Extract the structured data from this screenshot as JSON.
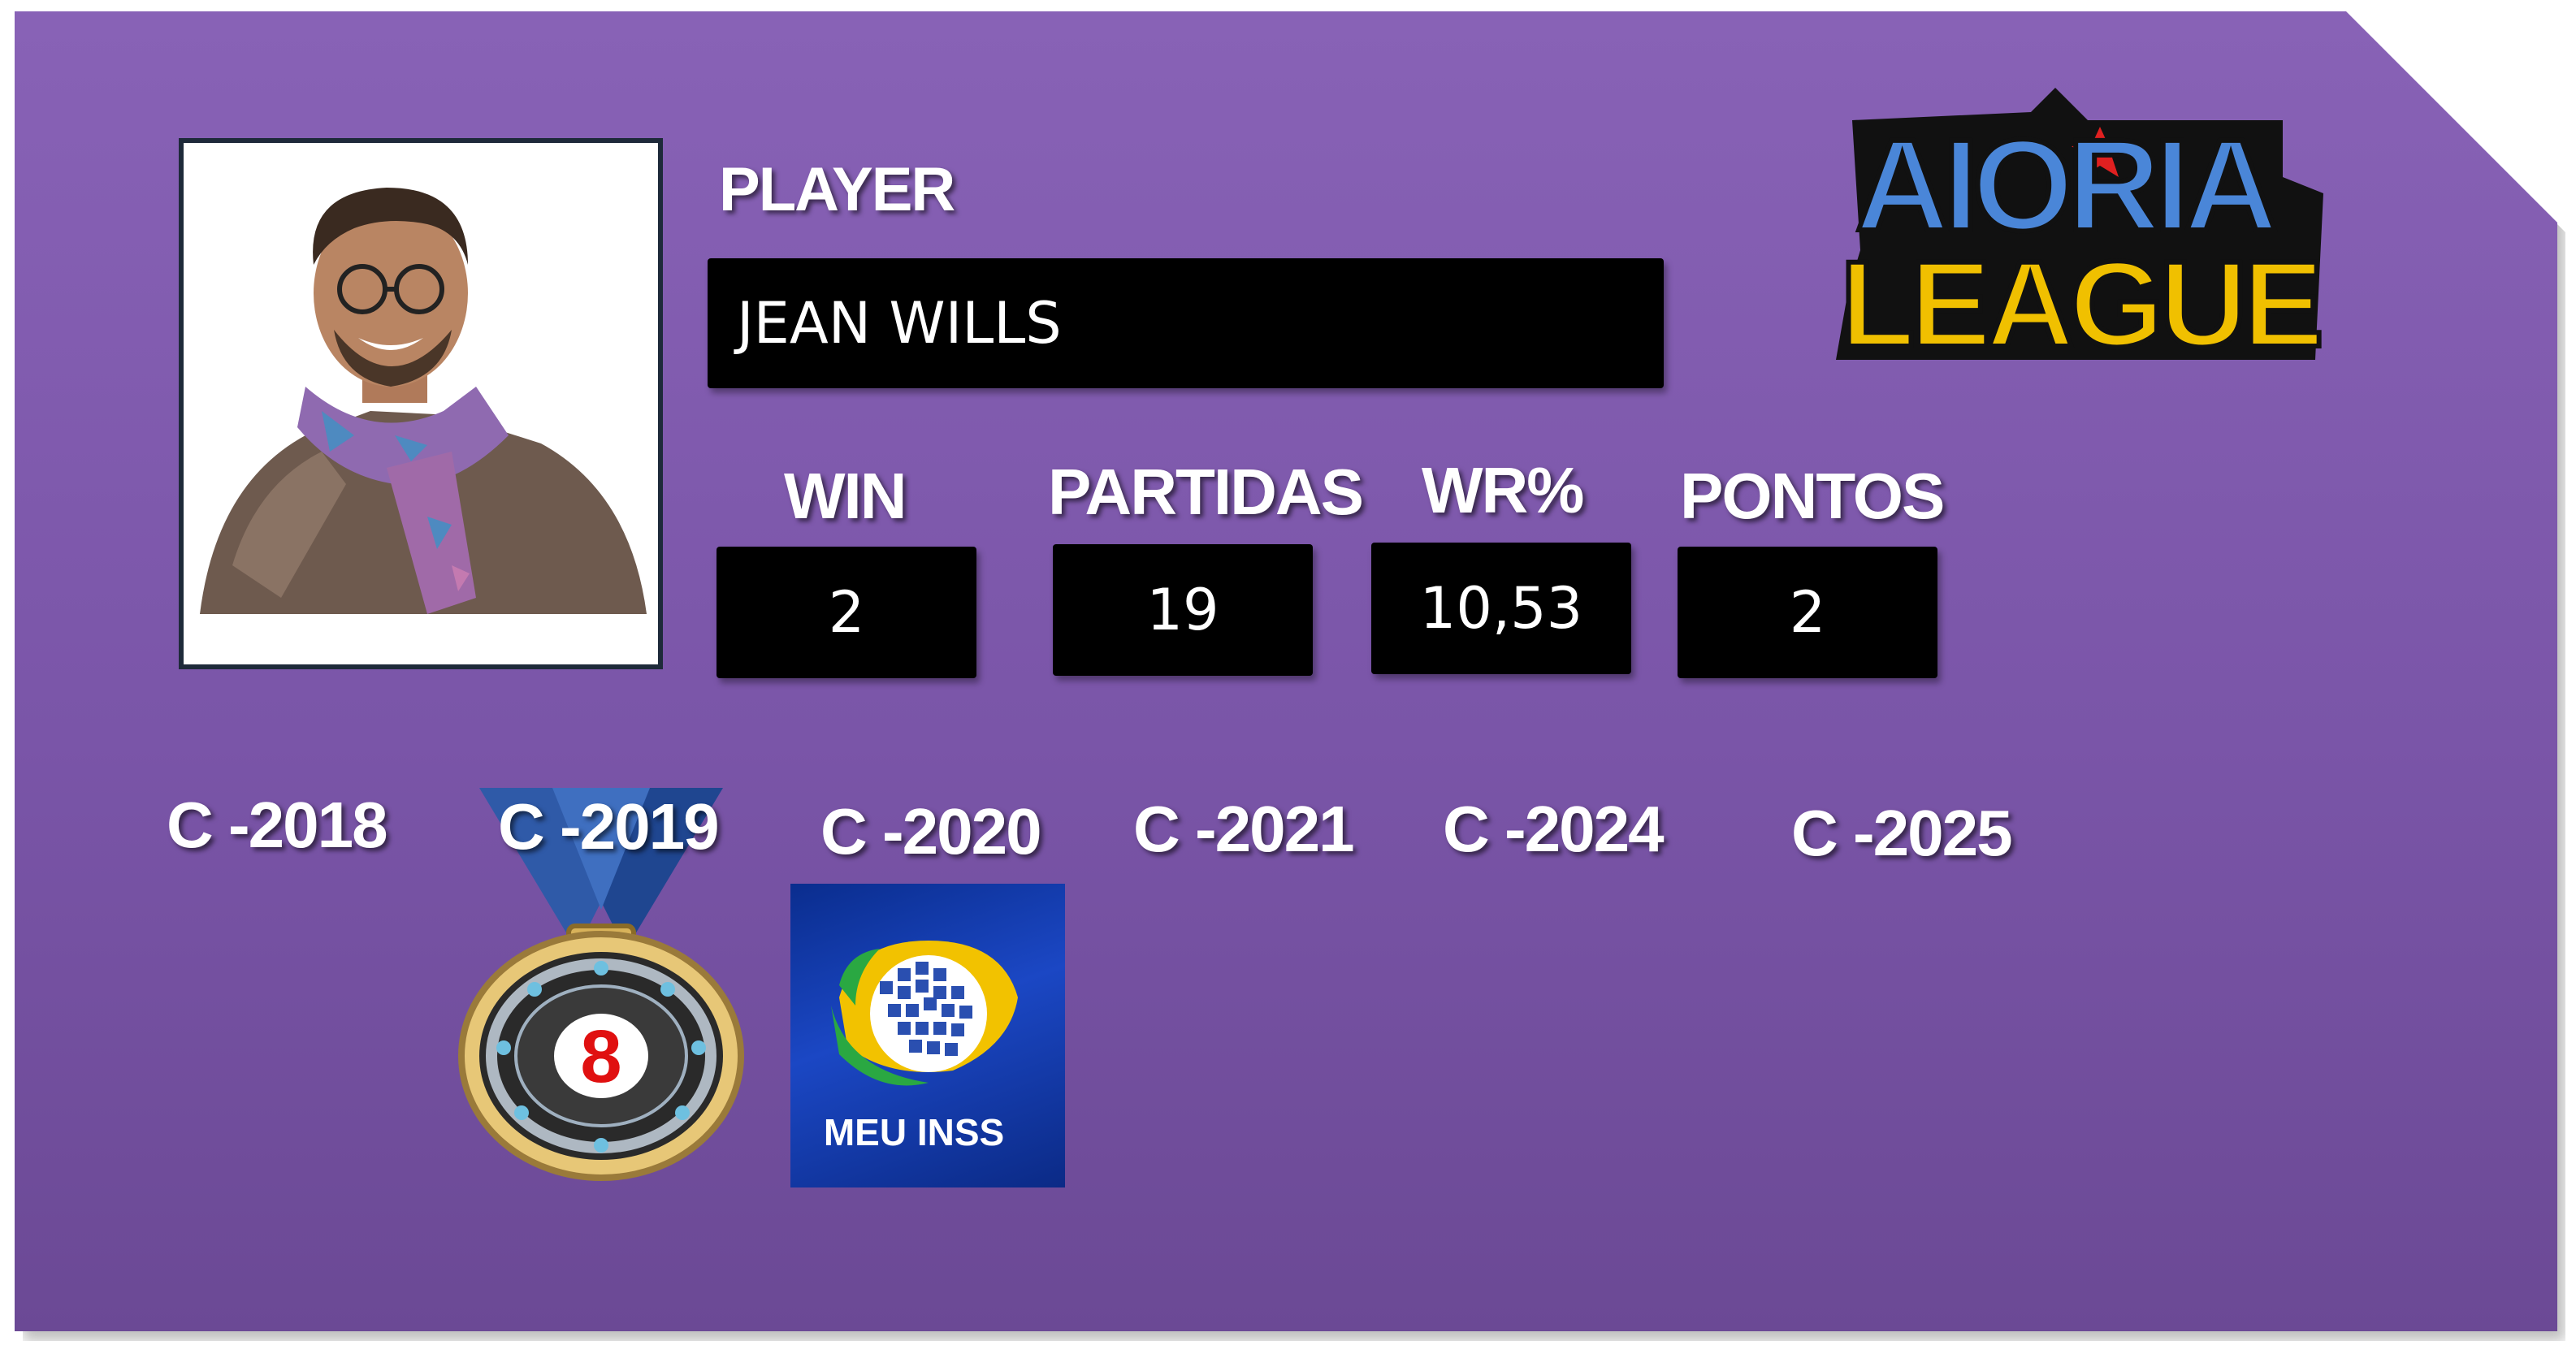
{
  "player": {
    "section_label": "PLAYER",
    "name": "JEAN WILLS"
  },
  "logo": {
    "line1": "AIORIA",
    "line2": "LEAGUE",
    "colors": {
      "top": "#4a86d8",
      "bottom": "#f0c000",
      "outline": "#111111",
      "star": "#e02020"
    }
  },
  "stats": [
    {
      "label": "WIN",
      "value": "2"
    },
    {
      "label": "PARTIDAS",
      "value": "19"
    },
    {
      "label": "WR%",
      "value": "10,53"
    },
    {
      "label": "PONTOS",
      "value": "2"
    }
  ],
  "seasons": [
    {
      "label": "C -2018"
    },
    {
      "label": "C -2019",
      "badge": "medal-8"
    },
    {
      "label": "C -2020",
      "badge": "meu-inss"
    },
    {
      "label": "C -2021"
    },
    {
      "label": "C -2024"
    },
    {
      "label": "C -2025"
    }
  ],
  "badges": {
    "medal_number": "8",
    "inss_text": "MEU INSS"
  },
  "colors": {
    "card_background": "#8862b6",
    "value_box": "#000000",
    "text": "#ffffff"
  }
}
